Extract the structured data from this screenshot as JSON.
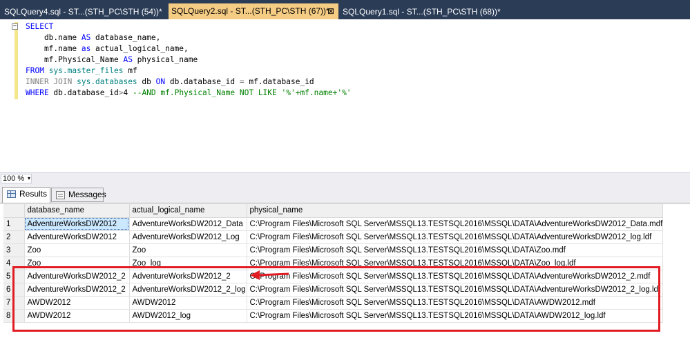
{
  "tabs": [
    {
      "label": "SQLQuery4.sql - ST...(STH_PC\\STH (54))*",
      "active": false
    },
    {
      "label": "SQLQuery2.sql - ST...(STH_PC\\STH (67))*",
      "active": true,
      "close": "⊠"
    },
    {
      "label": "SQLQuery1.sql - ST...(STH_PC\\STH (68))*",
      "active": false
    }
  ],
  "editor": {
    "collapse_glyph": "−",
    "lines": [
      [
        {
          "t": "SELECT",
          "c": "kw"
        }
      ],
      [
        {
          "t": "    db.name ",
          "c": "plain"
        },
        {
          "t": "AS",
          "c": "kw"
        },
        {
          "t": " database_name,",
          "c": "plain"
        }
      ],
      [
        {
          "t": "    mf.name ",
          "c": "plain"
        },
        {
          "t": "as",
          "c": "kw"
        },
        {
          "t": " actual_logical_name,",
          "c": "plain"
        }
      ],
      [
        {
          "t": "    mf.Physical_Name ",
          "c": "plain"
        },
        {
          "t": "AS",
          "c": "kw"
        },
        {
          "t": " physical_name",
          "c": "plain"
        }
      ],
      [
        {
          "t": "FROM",
          "c": "kw"
        },
        {
          "t": " ",
          "c": "plain"
        },
        {
          "t": "sys.master_files",
          "c": "fn"
        },
        {
          "t": " mf",
          "c": "plain"
        }
      ],
      [
        {
          "t": "INNER JOIN",
          "c": "gray"
        },
        {
          "t": " ",
          "c": "plain"
        },
        {
          "t": "sys.databases",
          "c": "fn"
        },
        {
          "t": " db ",
          "c": "plain"
        },
        {
          "t": "ON",
          "c": "kw"
        },
        {
          "t": " db.database_id ",
          "c": "plain"
        },
        {
          "t": "=",
          "c": "gray"
        },
        {
          "t": " mf.database_id",
          "c": "plain"
        }
      ],
      [
        {
          "t": "WHERE",
          "c": "kw"
        },
        {
          "t": " db.database_id",
          "c": "plain"
        },
        {
          "t": ">",
          "c": "gray"
        },
        {
          "t": "4 ",
          "c": "plain"
        },
        {
          "t": "--AND mf.Physical_Name NOT LIKE '%'+mf.name+'%'",
          "c": "cmt"
        }
      ]
    ]
  },
  "zoom": {
    "value": "100 %",
    "arrow": "▾"
  },
  "result_tabs": [
    {
      "label": "Results",
      "active": true
    },
    {
      "label": "Messages",
      "active": false
    }
  ],
  "grid": {
    "columns": [
      "",
      "database_name",
      "actual_logical_name",
      "physical_name"
    ],
    "rows": [
      [
        "1",
        "AdventureWorksDW2012",
        "AdventureWorksDW2012_Data",
        "C:\\Program Files\\Microsoft SQL Server\\MSSQL13.TESTSQL2016\\MSSQL\\DATA\\AdventureWorksDW2012_Data.mdf"
      ],
      [
        "2",
        "AdventureWorksDW2012",
        "AdventureWorksDW2012_Log",
        "C:\\Program Files\\Microsoft SQL Server\\MSSQL13.TESTSQL2016\\MSSQL\\DATA\\AdventureWorksDW2012_log.ldf"
      ],
      [
        "3",
        "Zoo",
        "Zoo",
        "C:\\Program Files\\Microsoft SQL Server\\MSSQL13.TESTSQL2016\\MSSQL\\DATA\\Zoo.mdf"
      ],
      [
        "4",
        "Zoo",
        "Zoo_log",
        "C:\\Program Files\\Microsoft SQL Server\\MSSQL13.TESTSQL2016\\MSSQL\\DATA\\Zoo_log.ldf"
      ],
      [
        "5",
        "AdventureWorksDW2012_2",
        "AdventureWorksDW2012_2",
        "C:\\Program Files\\Microsoft SQL Server\\MSSQL13.TESTSQL2016\\MSSQL\\DATA\\AdventureWorksDW2012_2.mdf"
      ],
      [
        "6",
        "AdventureWorksDW2012_2",
        "AdventureWorksDW2012_2_log",
        "C:\\Program Files\\Microsoft SQL Server\\MSSQL13.TESTSQL2016\\MSSQL\\DATA\\AdventureWorksDW2012_2_log.ldf"
      ],
      [
        "7",
        "AWDW2012",
        "AWDW2012",
        "C:\\Program Files\\Microsoft SQL Server\\MSSQL13.TESTSQL2016\\MSSQL\\DATA\\AWDW2012.mdf"
      ],
      [
        "8",
        "AWDW2012",
        "AWDW2012_log",
        "C:\\Program Files\\Microsoft SQL Server\\MSSQL13.TESTSQL2016\\MSSQL\\DATA\\AWDW2012_log.ldf"
      ]
    ]
  },
  "colors": {
    "annotation": "#e11b22",
    "tab_active": "#f5cc84",
    "tabstrip": "#2b3c57"
  }
}
